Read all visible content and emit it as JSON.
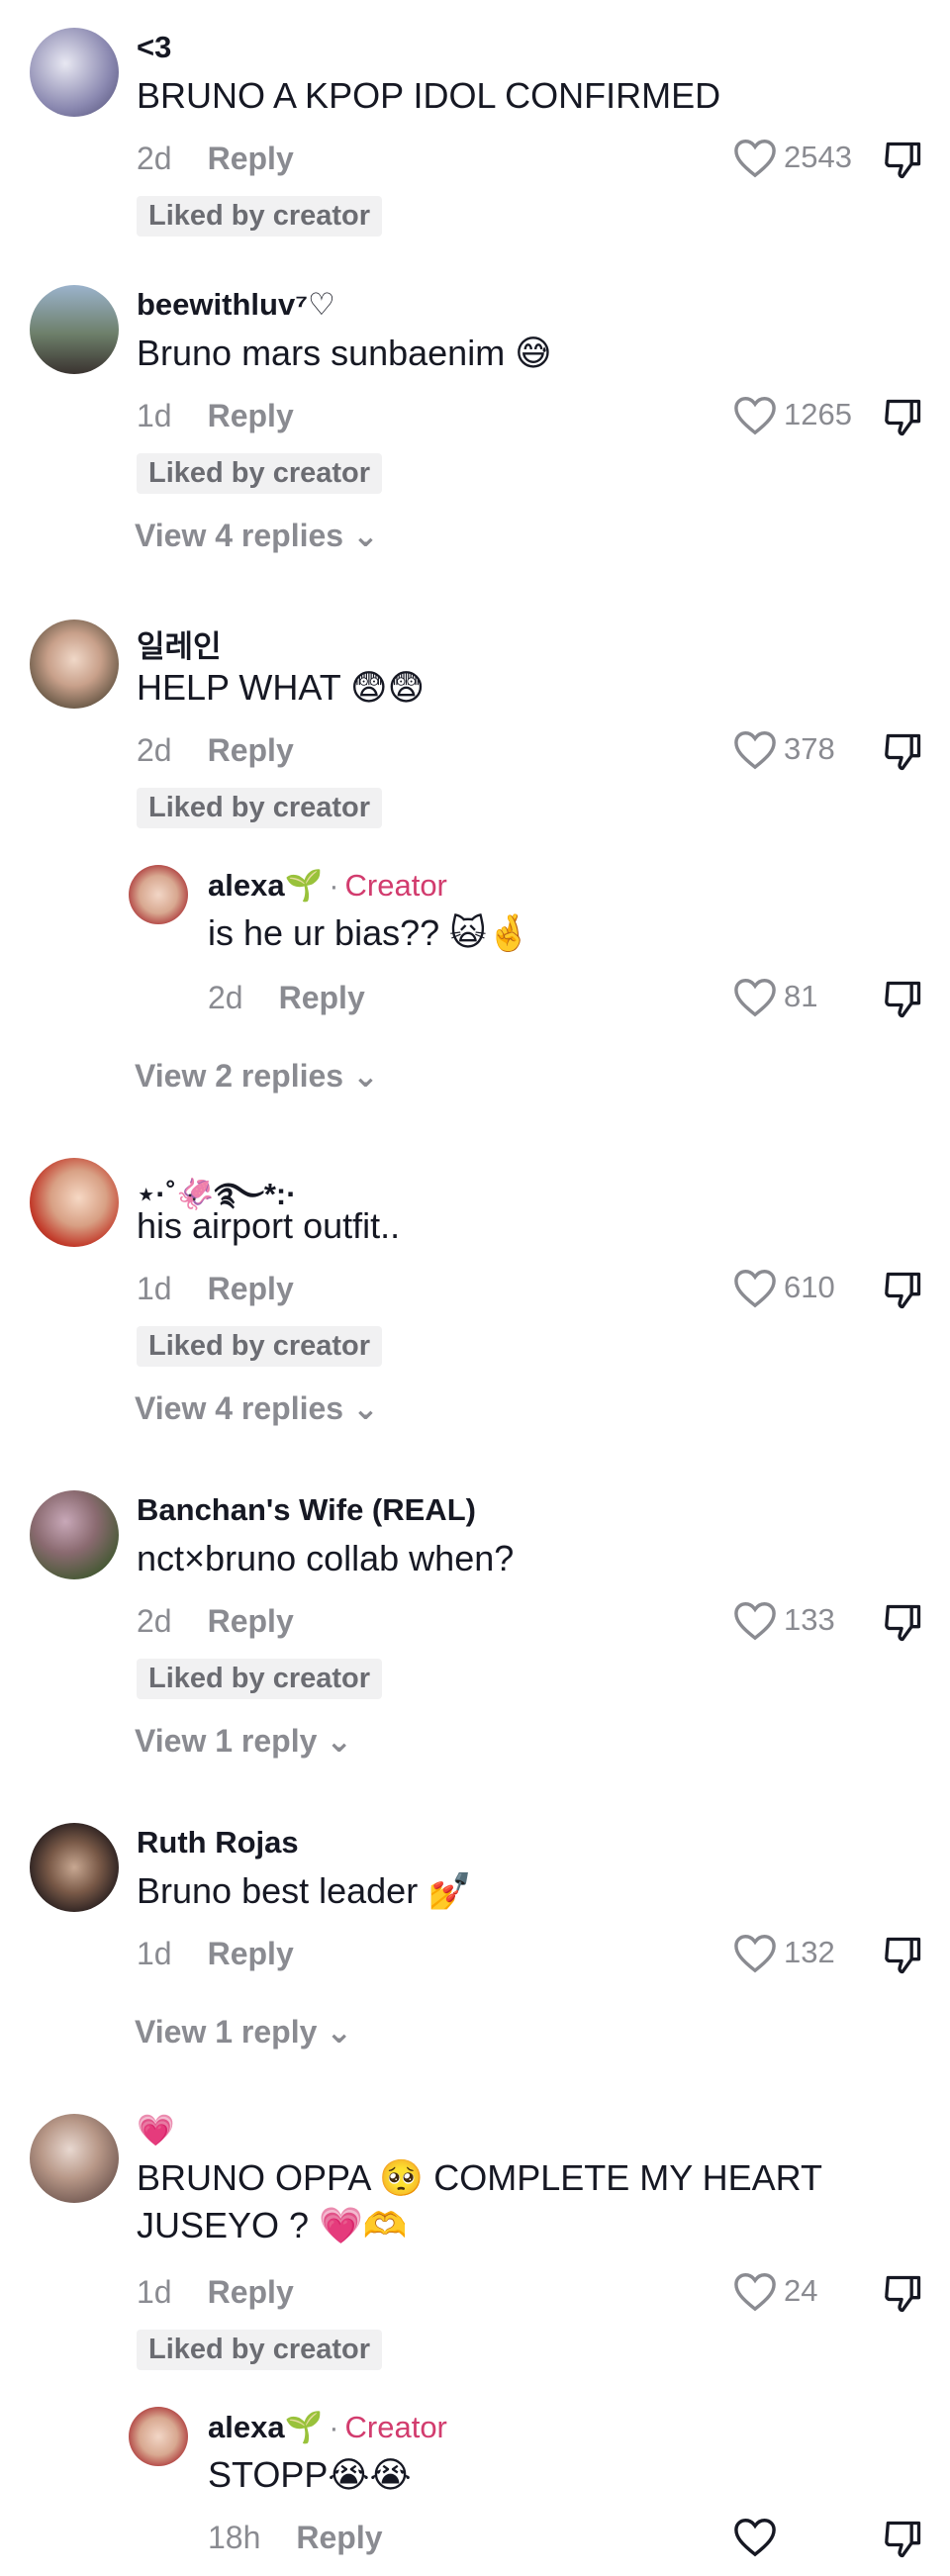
{
  "comments": [
    {
      "username": "<3",
      "text": "BRUNO A KPOP IDOL CONFIRMED",
      "time": "2d",
      "reply_label": "Reply",
      "likes": "2543",
      "liked_by_creator": "Liked by creator"
    },
    {
      "username": "beewithluv⁷♡",
      "text": "Bruno mars sunbaenim 😅",
      "time": "1d",
      "reply_label": "Reply",
      "likes": "1265",
      "liked_by_creator": "Liked by creator",
      "view_replies": "View 4 replies ⌄"
    },
    {
      "username": "일레인",
      "text": "HELP WHAT 😨😨",
      "time": "2d",
      "reply_label": "Reply",
      "likes": "378",
      "liked_by_creator": "Liked by creator",
      "reply": {
        "username": "alexa🌱",
        "tag": "Creator",
        "separator": "·",
        "text": "is he ur bias?? 🙀🤞",
        "time": "2d",
        "reply_label": "Reply",
        "likes": "81"
      },
      "view_replies": "View 2 replies ⌄"
    },
    {
      "username": "⋆·˚🦑࿐*:·",
      "text": "his airport outfit..",
      "time": "1d",
      "reply_label": "Reply",
      "likes": "610",
      "liked_by_creator": "Liked by creator",
      "view_replies": "View 4 replies ⌄"
    },
    {
      "username": "Banchan's Wife (REAL)",
      "text": "nct×bruno collab when?",
      "time": "2d",
      "reply_label": "Reply",
      "likes": "133",
      "liked_by_creator": "Liked by creator",
      "view_replies": "View 1 reply ⌄"
    },
    {
      "username": "Ruth Rojas",
      "text": "Bruno best leader 💅",
      "time": "1d",
      "reply_label": "Reply",
      "likes": "132",
      "view_replies": "View 1 reply ⌄"
    },
    {
      "username": "💗",
      "text_line1": "BRUNO OPPA 🥺 COMPLETE MY HEART",
      "text_line2": "JUSEYO ? 💗🫶",
      "time": "1d",
      "reply_label": "Reply",
      "likes": "24",
      "liked_by_creator": "Liked by creator",
      "reply": {
        "username": "alexa🌱",
        "tag": "Creator",
        "separator": "·",
        "text": "STOPP😭😭",
        "time": "18h",
        "reply_label": "Reply"
      }
    }
  ]
}
